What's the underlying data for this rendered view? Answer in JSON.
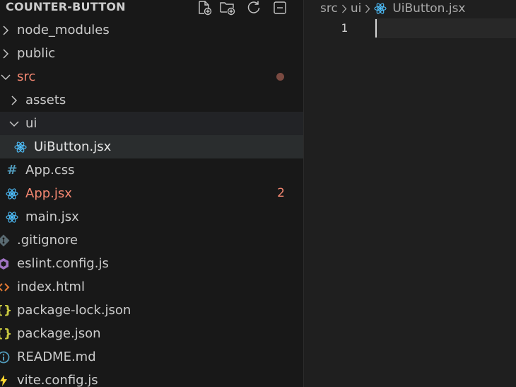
{
  "explorer": {
    "project_title": "COUNTER-BUTTON",
    "actions": [
      {
        "name": "new-file-icon"
      },
      {
        "name": "new-folder-icon"
      },
      {
        "name": "refresh-icon"
      },
      {
        "name": "collapse-all-icon"
      }
    ],
    "tree": [
      {
        "label": "node_modules",
        "kind": "folder",
        "expanded": false
      },
      {
        "label": "public",
        "kind": "folder",
        "expanded": false
      },
      {
        "label": "src",
        "kind": "folder",
        "expanded": true,
        "modified": true,
        "dot": true
      },
      {
        "label": "assets",
        "kind": "folder",
        "expanded": false
      },
      {
        "label": "ui",
        "kind": "folder",
        "expanded": true
      },
      {
        "label": "UiButton.jsx",
        "kind": "file",
        "icon": "react-icon",
        "selected": true
      },
      {
        "label": "App.css",
        "kind": "file",
        "icon": "hash-icon"
      },
      {
        "label": "App.jsx",
        "kind": "file",
        "icon": "react-icon",
        "modified": true,
        "badge": "2"
      },
      {
        "label": "main.jsx",
        "kind": "file",
        "icon": "react-icon"
      },
      {
        "label": ".gitignore",
        "kind": "file",
        "icon": "git-icon"
      },
      {
        "label": "eslint.config.js",
        "kind": "file",
        "icon": "eslint-icon"
      },
      {
        "label": "index.html",
        "kind": "file",
        "icon": "html-icon"
      },
      {
        "label": "package-lock.json",
        "kind": "file",
        "icon": "json-icon"
      },
      {
        "label": "package.json",
        "kind": "file",
        "icon": "json-icon"
      },
      {
        "label": "README.md",
        "kind": "file",
        "icon": "info-icon"
      },
      {
        "label": "vite.config.js",
        "kind": "file",
        "icon": "vite-icon"
      }
    ]
  },
  "editor": {
    "breadcrumb": [
      "src",
      "ui",
      "UiButton.jsx"
    ],
    "breadcrumb_file_icon": "react-icon",
    "line_numbers": [
      "1"
    ]
  },
  "colors": {
    "modified": "#f48771",
    "react": "#4fc1ff",
    "json": "#cbcb41",
    "html": "#e37933",
    "eslint": "#a074c4",
    "info": "#519aba",
    "git": "#41535b",
    "vite": "#ffd62e"
  }
}
